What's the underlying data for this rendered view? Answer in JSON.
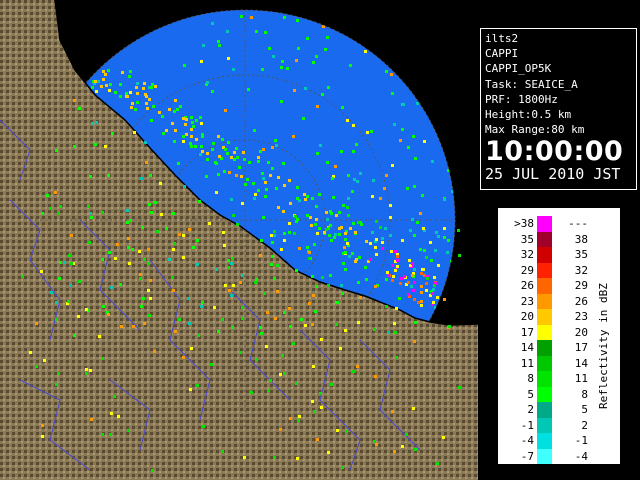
{
  "info": {
    "station": "ilts2",
    "product": "CAPPI",
    "product_id": "CAPPI_OP5K",
    "task": "Task: SEAICE_A",
    "prf": "PRF: 1800Hz",
    "height": "Height:0.5 km",
    "max_range": "Max Range:80 km",
    "time": "10:00:00",
    "date": "25 JUL 2010 JST"
  },
  "legend": {
    "unit": "Reflectivity in dBZ",
    "rows": [
      {
        "lo": ">38",
        "hi": "---",
        "color": "#ff00ff"
      },
      {
        "lo": "35",
        "hi": "38",
        "color": "#a0002a"
      },
      {
        "lo": "32",
        "hi": "35",
        "color": "#d00000"
      },
      {
        "lo": "29",
        "hi": "32",
        "color": "#ff2200"
      },
      {
        "lo": "26",
        "hi": "29",
        "color": "#ff6600"
      },
      {
        "lo": "23",
        "hi": "26",
        "color": "#ff9900"
      },
      {
        "lo": "20",
        "hi": "23",
        "color": "#ffc800"
      },
      {
        "lo": "17",
        "hi": "20",
        "color": "#ffff00"
      },
      {
        "lo": "14",
        "hi": "17",
        "color": "#00a000"
      },
      {
        "lo": "11",
        "hi": "14",
        "color": "#00c800"
      },
      {
        "lo": "8",
        "hi": "11",
        "color": "#00e400"
      },
      {
        "lo": "5",
        "hi": "8",
        "color": "#00ff00"
      },
      {
        "lo": "2",
        "hi": "5",
        "color": "#00aa88"
      },
      {
        "lo": "-1",
        "hi": "2",
        "color": "#00c8b4"
      },
      {
        "lo": "-4",
        "hi": "-1",
        "color": "#00e0e0"
      },
      {
        "lo": "-7",
        "hi": "-4",
        "color": "#40ffff"
      }
    ]
  },
  "map": {
    "sea_color": "#0060f0",
    "sea_circle_color": "#1a6af0",
    "range_ring_color": "#555555",
    "land_color": "#8a7a58",
    "land_dark_color": "#4a3a20",
    "river_color": "#4a4ad0",
    "coast_color": "#000000"
  }
}
